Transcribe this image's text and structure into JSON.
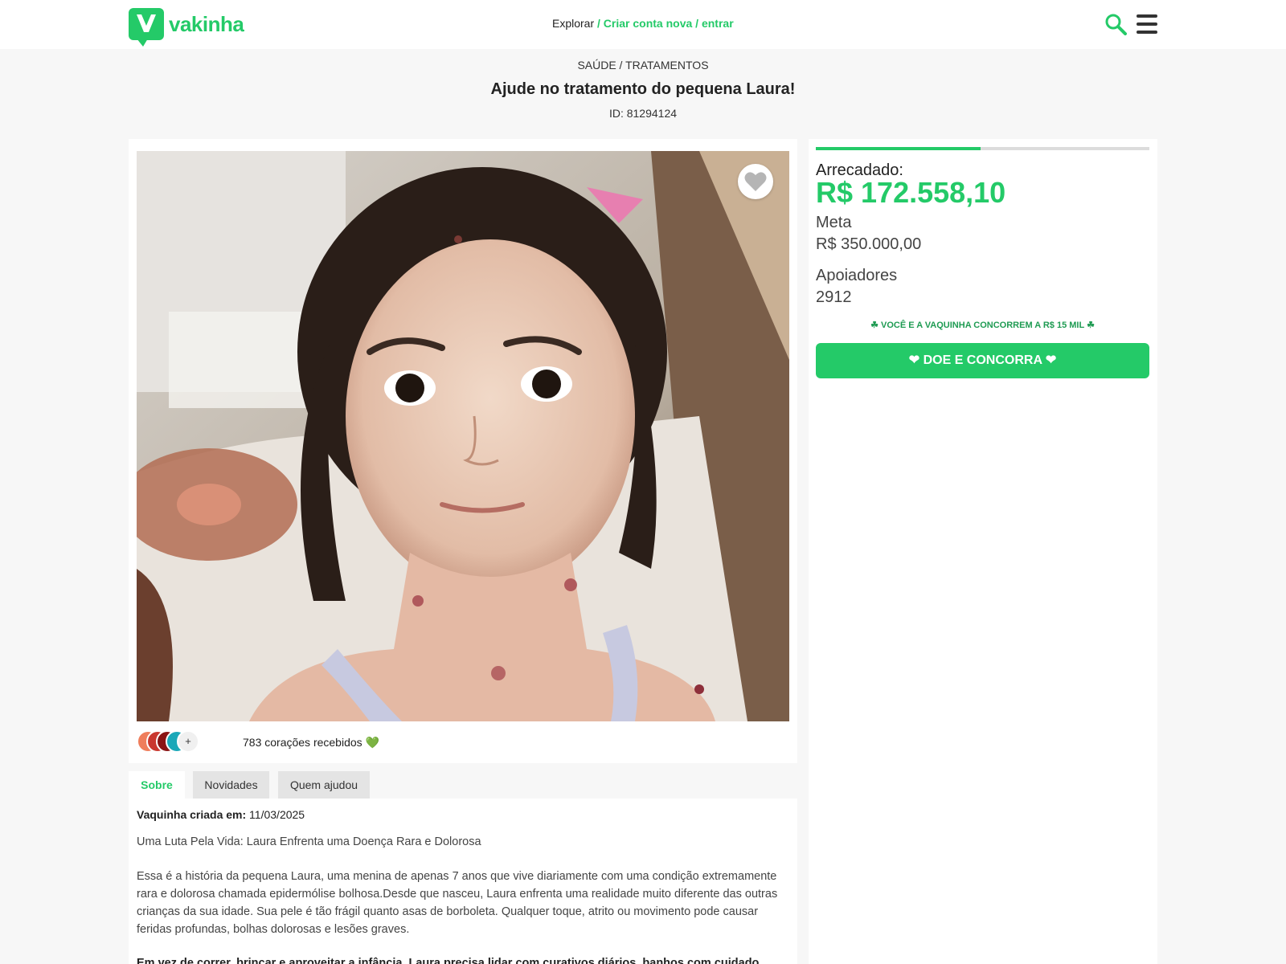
{
  "header": {
    "logo_text": "vakinha",
    "nav_explore": "Explorar",
    "nav_rest": "/ Criar conta nova / entrar"
  },
  "campaign": {
    "category": "SAÚDE / TRATAMENTOS",
    "title": "Ajude no tratamento do pequena Laura!",
    "id_text": "ID: 81294124"
  },
  "media": {
    "hearts_text": "783 corações recebidos 💚",
    "avatars_more": "+"
  },
  "tabs": [
    {
      "label": "Sobre"
    },
    {
      "label": "Novidades"
    },
    {
      "label": "Quem ajudou"
    }
  ],
  "about": {
    "created_label": "Vaquinha criada em:",
    "created_date": " 11/03/2025",
    "heading": "Uma Luta Pela Vida: Laura Enfrenta uma Doença Rara e Dolorosa",
    "paragraph": "Essa é a história da pequena Laura, uma menina de apenas 7 anos que vive diariamente com uma condição extremamente rara e dolorosa chamada epidermólise bolhosa.Desde que nasceu, Laura enfrenta uma realidade muito diferente das outras crianças da sua idade. Sua pele é tão frágil quanto asas de borboleta. Qualquer toque, atrito ou movimento pode causar feridas profundas, bolhas dolorosas e lesões graves.",
    "paragraph_bold": "Em vez de correr, brincar e aproveitar a infância, Laura precisa lidar com curativos diários, banhos com cuidado"
  },
  "stats": {
    "raised_label": "Arrecadado:",
    "raised_value": "R$ 172.558,10",
    "goal_label": "Meta",
    "goal_value": "R$ 350.000,00",
    "supporters_label": "Apoiadores",
    "supporters_value": "2912",
    "progress_fraction": 0.493,
    "promo": "☘ VOCÊ E A VAQUINHA CONCORREM A R$ 15 MIL ☘",
    "donate_label": "❤ DOE E CONCORRA ❤"
  },
  "colors": {
    "brand": "#24ca68",
    "background": "#f7f7f7"
  }
}
